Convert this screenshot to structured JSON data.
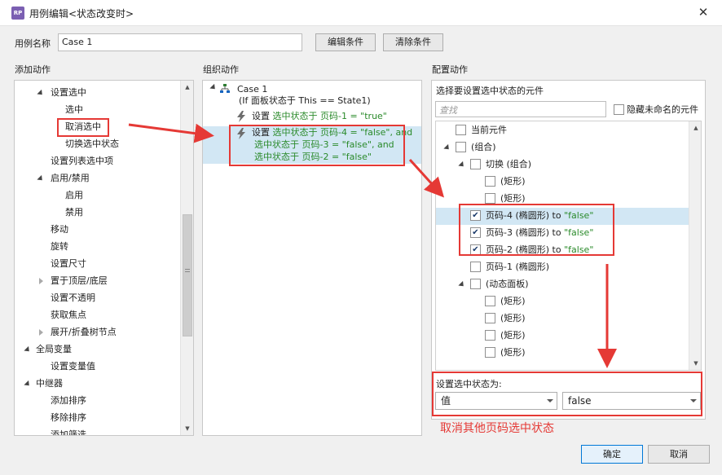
{
  "window": {
    "title": "用例编辑<状态改变时>",
    "app_icon": "RP"
  },
  "usecase": {
    "name_label": "用例名称",
    "name_value": "Case 1",
    "edit_btn": "编辑条件",
    "clear_btn": "清除条件"
  },
  "left": {
    "header": "添加动作",
    "items": [
      {
        "label": "设置选中",
        "level": 1,
        "toggle": "down"
      },
      {
        "label": "选中",
        "level": 2
      },
      {
        "label": "取消选中",
        "level": 2
      },
      {
        "label": "切换选中状态",
        "level": 2
      },
      {
        "label": "设置列表选中项",
        "level": 1
      },
      {
        "label": "启用/禁用",
        "level": 1,
        "toggle": "down"
      },
      {
        "label": "启用",
        "level": 2
      },
      {
        "label": "禁用",
        "level": 2
      },
      {
        "label": "移动",
        "level": 1
      },
      {
        "label": "旋转",
        "level": 1
      },
      {
        "label": "设置尺寸",
        "level": 1
      },
      {
        "label": "置于顶层/底层",
        "level": 1,
        "toggle": "right"
      },
      {
        "label": "设置不透明",
        "level": 1
      },
      {
        "label": "获取焦点",
        "level": 1
      },
      {
        "label": "展开/折叠树节点",
        "level": 1,
        "toggle": "right"
      },
      {
        "label": "全局变量",
        "level": 0,
        "toggle": "down"
      },
      {
        "label": "设置变量值",
        "level": 1
      },
      {
        "label": "中继器",
        "level": 0,
        "toggle": "down"
      },
      {
        "label": "添加排序",
        "level": 1
      },
      {
        "label": "移除排序",
        "level": 1
      },
      {
        "label": "添加筛选",
        "level": 1
      }
    ]
  },
  "middle": {
    "header": "组织动作",
    "case_title": "Case 1",
    "case_condition": "(If 面板状态于 This == State1)",
    "action1": {
      "prefix": "设置 ",
      "green": "选中状态于 页码-1 = \"true\""
    },
    "action2": {
      "line1_prefix": "设置 ",
      "line1_green": "选中状态于 页码-4 = \"false\", and",
      "line2": "选中状态于 页码-3 = \"false\", and",
      "line3": "选中状态于 页码-2 = \"false\""
    }
  },
  "right": {
    "header": "配置动作",
    "select_label": "选择要设置选中状态的元件",
    "search_placeholder": "查找",
    "hide_unnamed": "隐藏未命名的元件",
    "tree": [
      {
        "label": "当前元件",
        "level": 0,
        "checked": false
      },
      {
        "label": "(组合)",
        "level": 0,
        "toggle": true,
        "checked": false
      },
      {
        "label": "切换 (组合)",
        "level": 1,
        "toggle": true,
        "checked": false
      },
      {
        "label": "(矩形)",
        "level": 2,
        "checked": false
      },
      {
        "label": "(矩形)",
        "level": 2,
        "checked": false
      },
      {
        "label": "页码-4 (椭圆形) to ",
        "value": "\"false\"",
        "level": 1,
        "checked": true,
        "highlight": true
      },
      {
        "label": "页码-3 (椭圆形) to ",
        "value": "\"false\"",
        "level": 1,
        "checked": true
      },
      {
        "label": "页码-2 (椭圆形) to ",
        "value": "\"false\"",
        "level": 1,
        "checked": true
      },
      {
        "label": "页码-1 (椭圆形)",
        "level": 1,
        "checked": false
      },
      {
        "label": "(动态面板)",
        "level": 1,
        "toggle": true,
        "checked": false
      },
      {
        "label": "(矩形)",
        "level": 2,
        "checked": false
      },
      {
        "label": "(矩形)",
        "level": 2,
        "checked": false
      },
      {
        "label": "(矩形)",
        "level": 2,
        "checked": false
      },
      {
        "label": "(矩形)",
        "level": 2,
        "checked": false
      }
    ],
    "set_state_label": "设置选中状态为:",
    "select_type": "值",
    "select_value": "false",
    "annotation": "取消其他页码选中状态"
  },
  "footer": {
    "ok": "确定",
    "cancel": "取消"
  },
  "colors": {
    "annotation": "#e53935",
    "green_text": "#2a8a2a",
    "highlight": "#d2e7f4"
  }
}
